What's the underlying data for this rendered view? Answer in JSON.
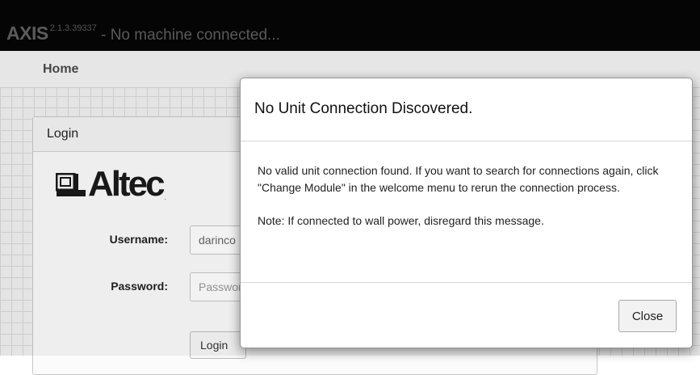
{
  "window": {
    "app_name": "AXIS",
    "version": "2.1.3.39337",
    "status": " - No machine connected..."
  },
  "nav": {
    "home_label": "Home"
  },
  "login": {
    "panel_title": "Login",
    "logo_text": "Altec",
    "logo_reg": ".",
    "username_label": "Username:",
    "username_value": "darinco",
    "password_label": "Password:",
    "password_placeholder": "Password",
    "submit_label": "Login"
  },
  "modal": {
    "title": "No Unit Connection Discovered.",
    "message": "No valid unit connection found. If you want to search for connections again, click \"Change Module\" in the welcome menu to rerun the connection process.",
    "note": "Note: If connected to wall power, disregard this message.",
    "close_label": "Close"
  },
  "colors": {
    "topbar_bg": "#060606",
    "page_bg": "#f1f1f1",
    "modal_bg": "#ffffff"
  }
}
